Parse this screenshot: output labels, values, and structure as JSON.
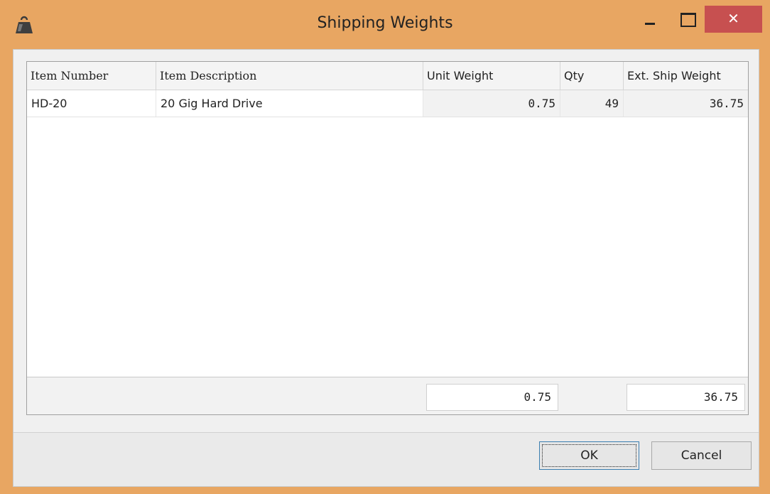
{
  "window": {
    "title": "Shipping Weights",
    "close_glyph": "✕",
    "accent": "#e8a662",
    "close_color": "#c75050"
  },
  "grid": {
    "columns": [
      "Item Number",
      "Item Description",
      "Unit Weight",
      "Qty",
      "Ext. Ship Weight"
    ],
    "rows": [
      {
        "item_number": "HD-20",
        "description": "20 Gig Hard Drive",
        "unit_weight": "0.75",
        "qty": "49",
        "ext_weight": "36.75"
      }
    ],
    "totals": {
      "unit_weight": "0.75",
      "ext_weight": "36.75"
    }
  },
  "buttons": {
    "ok": "OK",
    "cancel": "Cancel"
  },
  "icons": {
    "app": "weight-icon",
    "minimize": "minimize-icon",
    "maximize": "maximize-icon",
    "close": "close-icon"
  }
}
